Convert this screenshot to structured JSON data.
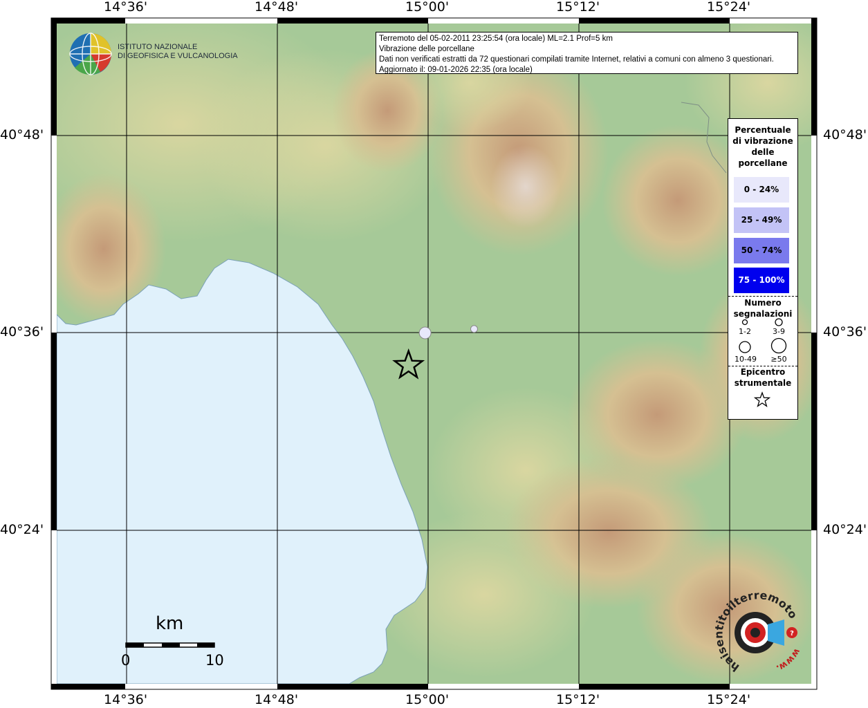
{
  "map": {
    "lon_labels": [
      "14°36'",
      "14°48'",
      "15°00'",
      "15°12'",
      "15°24'"
    ],
    "lat_labels": [
      "40°48'",
      "40°36'",
      "40°24'"
    ],
    "colors": {
      "sea": "#e0f1fb",
      "lowland": "#98c491",
      "hill": "#c9d29c",
      "mountain": "#c7a57e",
      "grid": "#000000"
    }
  },
  "info": {
    "line1": "Terremoto del 05-02-2011 23:25:54 (ora locale) ML=2.1 Prof=5 km",
    "line2": "Vibrazione delle porcellane",
    "line3": "Dati non verificati estratti da 72 questionari compilati tramite Internet, relativi a comuni con almeno 3 questionari.",
    "line4": "Aggiornato il: 09-01-2026 22:35 (ora locale)"
  },
  "logo": {
    "line1": "ISTITUTO NAZIONALE",
    "line2": "DI GEOFISICA E VULCANOLOGIA"
  },
  "legend": {
    "title_lines": [
      "Percentuale",
      "di vibrazione",
      "delle",
      "porcellane"
    ],
    "classes": [
      {
        "label": "0 - 24%",
        "color": "#e8e8fb"
      },
      {
        "label": "25 - 49%",
        "color": "#c3c3f6"
      },
      {
        "label": "50 - 74%",
        "color": "#7a7aed"
      },
      {
        "label": "75 - 100%",
        "color": "#0000ee"
      }
    ],
    "count_title_lines": [
      "Numero",
      "segnalazioni"
    ],
    "count_classes": [
      "1-2",
      "3-9",
      "10-49",
      "≥50"
    ],
    "epicenter_title_lines": [
      "Epicentro",
      "strumentale"
    ]
  },
  "scale": {
    "unit": "km",
    "start": "0",
    "end": "10"
  },
  "hsit_logo": {
    "text": "haisentitoilterremoto.it",
    "url_text": "www."
  },
  "observations": [
    {
      "lon": 14.996,
      "lat": 40.6,
      "count_class": "10-49",
      "percent_class": "0 - 24%"
    },
    {
      "lon": 15.061,
      "lat": 40.604,
      "count_class": "3-9",
      "percent_class": "0 - 24%"
    }
  ],
  "epicenter": {
    "lon": 14.974,
    "lat": 40.567
  }
}
